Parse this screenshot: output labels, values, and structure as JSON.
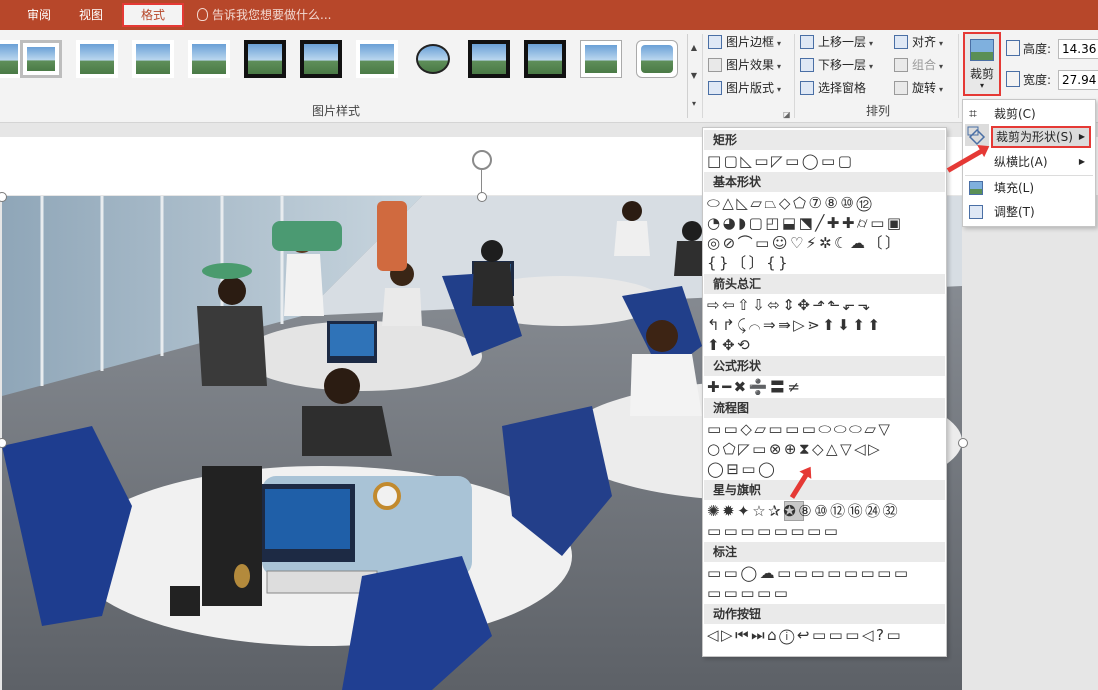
{
  "tabs": [
    {
      "label": "审阅",
      "active": false
    },
    {
      "label": "视图",
      "active": false
    },
    {
      "label": "格式",
      "active": true
    }
  ],
  "tell_me": "告诉我您想要做什么...",
  "ribbon": {
    "picture_styles_label": "图片样式",
    "picture_border": "图片边框",
    "picture_effects": "图片效果",
    "picture_layout": "图片版式",
    "arrange_label": "排列",
    "bring_forward": "上移一层",
    "send_backward": "下移一层",
    "selection_pane": "选择窗格",
    "align": "对齐",
    "group": "组合",
    "rotate": "旋转",
    "crop": "裁剪",
    "height_label": "高度:",
    "height_value": "14.36",
    "width_label": "宽度:",
    "width_value": "27.94"
  },
  "crop_menu": {
    "crop": "裁剪(C)",
    "crop_to_shape": "裁剪为形状(S)",
    "aspect_ratio": "纵横比(A)",
    "fill": "填充(L)",
    "fit": "调整(T)"
  },
  "shape_gallery": {
    "sections": [
      {
        "title": "矩形",
        "rows": [
          "□▢◺▭◸▭◯▭▢"
        ]
      },
      {
        "title": "基本形状",
        "rows": [
          "⬭△◺▱⏢◇⬠⑦⑧⑩⑫",
          "◔◕◗▢◰⬓⬔╱✚✚⌭▭▣",
          "◎⊘⌒▭☺♡⚡✲☾☁〔〕",
          "{}〔〕{}"
        ]
      },
      {
        "title": "箭头总汇",
        "rows": [
          "⇨⇦⇧⇩⬄⇕✥⬏⬑⬐⬎",
          "↰↱⤹⌒⇒⇛▷⋗⬆⬇⬆⬆",
          "⬆✥⟲"
        ]
      },
      {
        "title": "公式形状",
        "rows": [
          "✚━✖➗〓≠"
        ]
      },
      {
        "title": "流程图",
        "rows": [
          "▭▭◇▱▭▭▭⬭⬭⬭▱▽",
          "○⬠◸▭⊗⊕⧗◇△▽◁▷",
          "◯⊟▭◯"
        ]
      },
      {
        "title": "星与旗帜",
        "rows": [
          "✺✹✦☆✰✪⑧⑩⑫⑯㉔㉜",
          "▭▭▭▭▭▭▭▭"
        ]
      },
      {
        "title": "标注",
        "rows": [
          "▭▭◯☁▭▭▭▭▭▭▭▭",
          "▭▭▭▭▭"
        ]
      },
      {
        "title": "动作按钮",
        "rows": [
          "◁▷⏮⏭⌂ⓘ↩▭▭▭◁?▭"
        ]
      }
    ]
  }
}
